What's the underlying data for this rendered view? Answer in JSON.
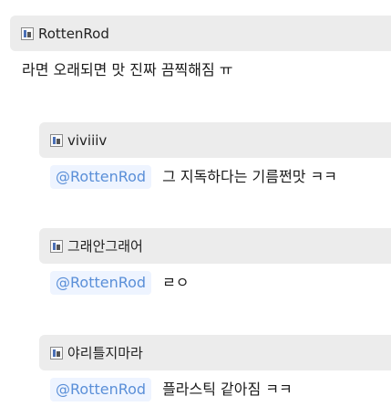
{
  "post": {
    "author": "RottenRod",
    "text": "라면 오래되면 맛 진짜 끔찍해짐 ㅠ"
  },
  "replies": [
    {
      "author": "viviiiv",
      "mention": "@RottenRod",
      "text": "그 지독하다는 기름쩐맛 ㅋㅋ"
    },
    {
      "author": "그래안그래어",
      "mention": "@RottenRod",
      "text": "ㄹㅇ"
    },
    {
      "author": "야리틀지마라",
      "mention": "@RottenRod",
      "text": "플라스틱 같아짐 ㅋㅋ"
    }
  ],
  "icons": {
    "author_badge": "user-badge-icon"
  }
}
